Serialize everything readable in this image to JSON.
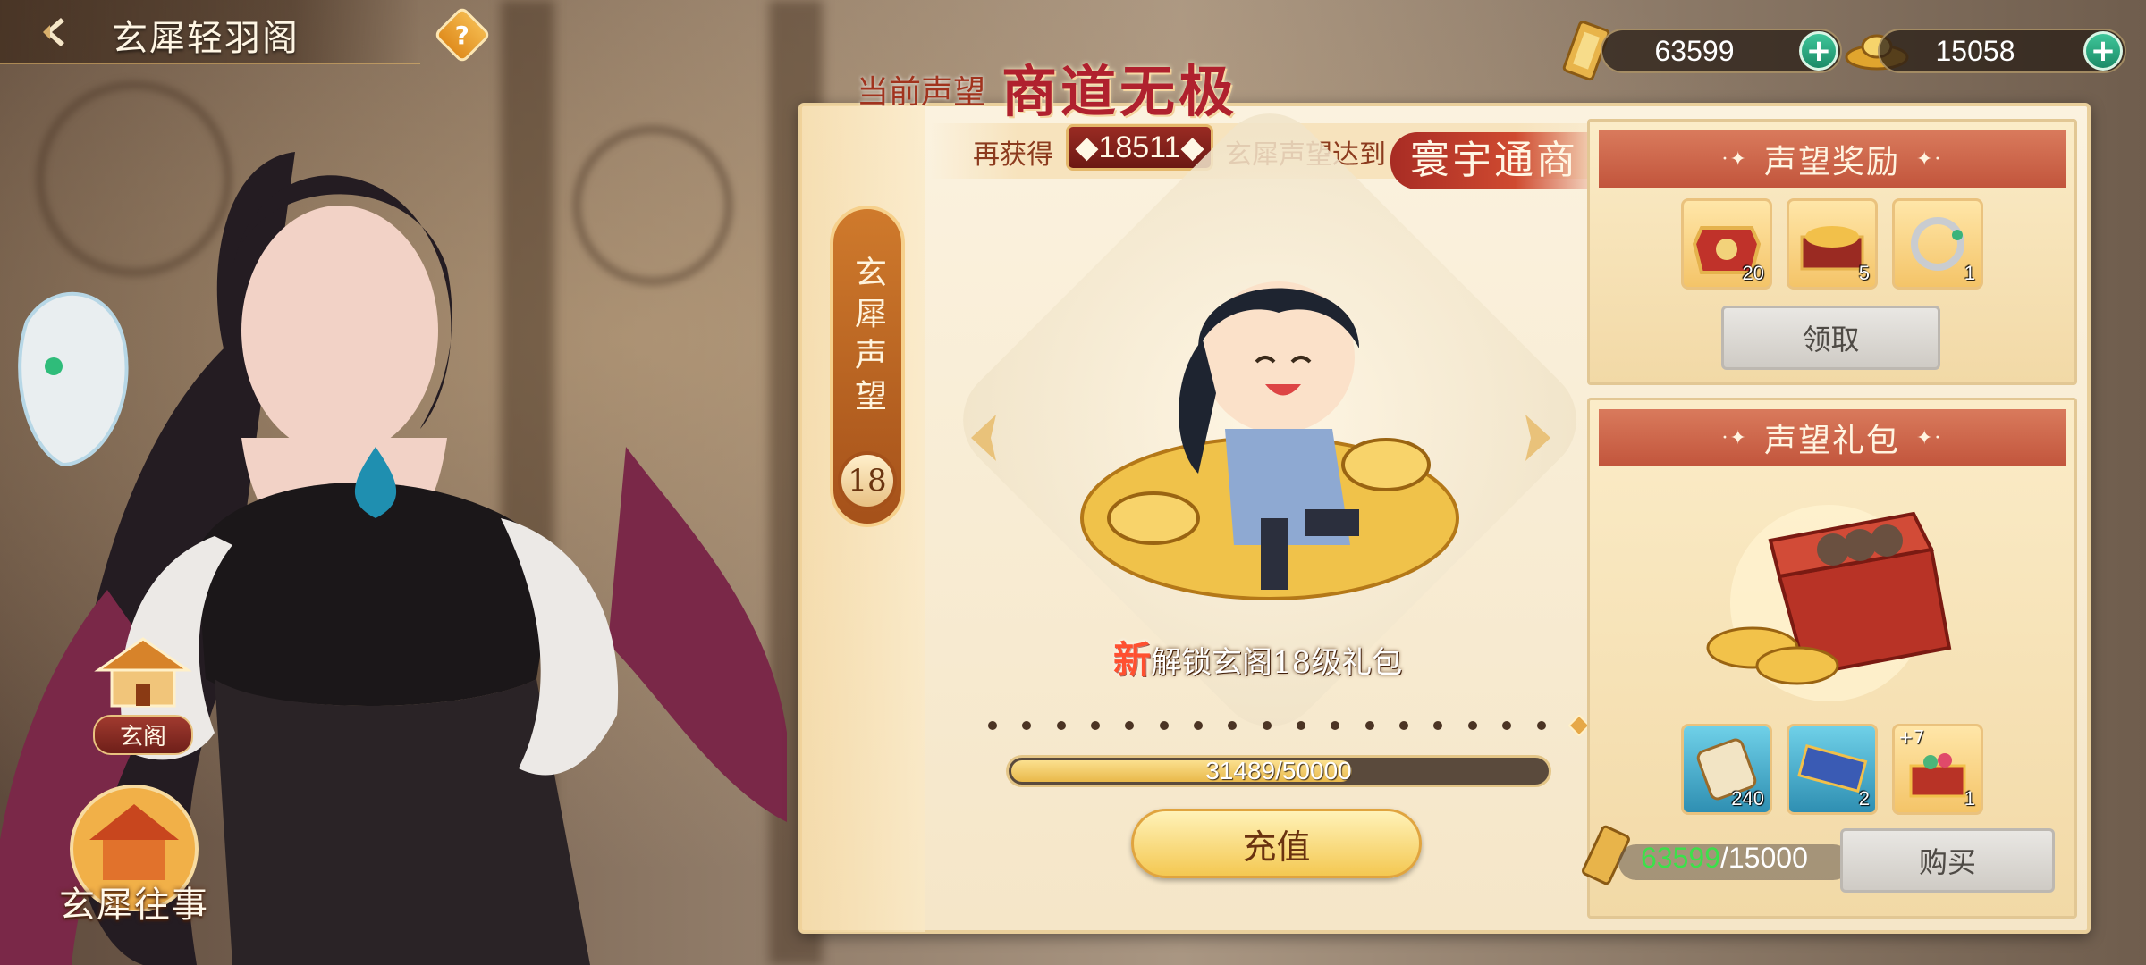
{
  "header": {
    "title": "玄犀轻羽阁",
    "help_label": "?"
  },
  "currencies": [
    {
      "name": "gold-ticket",
      "value": "63599"
    },
    {
      "name": "gold-ingot",
      "value": "15058"
    }
  ],
  "side_menu": {
    "item1_label": "玄阁",
    "item2_label": "玄犀往事"
  },
  "vertical_tab": {
    "label": "玄犀声望",
    "level": "18"
  },
  "rank": {
    "current_label": "当前声望",
    "current_name": "商道无极",
    "again_label": "再获得",
    "need_value": "◆18511◆",
    "reach_label": "玄犀声望达到",
    "next_name": "寰宇通商"
  },
  "showcase": {
    "new_badge": "新",
    "unlock_text": "解锁玄阁18级礼包"
  },
  "progress": {
    "text": "31489/50000",
    "fraction": 0.63
  },
  "recharge_label": "充值",
  "reward_card": {
    "title": "声望奖励",
    "items": [
      {
        "icon": "red-chest-icon",
        "count": "20"
      },
      {
        "icon": "treasure-box-icon",
        "count": "5"
      },
      {
        "icon": "silver-bracelet-icon",
        "count": "1"
      }
    ],
    "claim_label": "领取"
  },
  "gift_card": {
    "title": "声望礼包",
    "items": [
      {
        "icon": "scroll-icon",
        "count": "240"
      },
      {
        "icon": "blue-book-icon",
        "count": "2"
      },
      {
        "icon": "gift-chest-icon",
        "count": "1",
        "extra": "+7"
      }
    ],
    "price_have": "63599",
    "price_need": "/15000",
    "buy_label": "购买"
  },
  "colors": {
    "accent_red": "#b0212e",
    "panel_bg": "#fbf2df",
    "green_plus": "#1b8b67"
  }
}
